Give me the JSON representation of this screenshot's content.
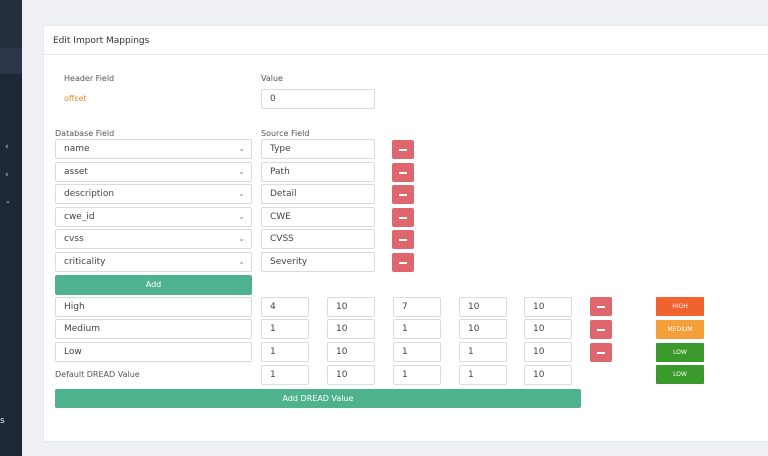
{
  "colors": {
    "sidebar": "#1e2736",
    "accent_green": "#4fb28f",
    "remove_red": "#e0666e",
    "badge_high": "#f0622e",
    "badge_medium": "#f59f3b",
    "badge_low": "#3a9a2c",
    "field_orange": "#e08a2b"
  },
  "sidebar": {
    "letter": "s"
  },
  "card": {
    "title": "Edit Import Mappings"
  },
  "header_section": {
    "header_field_label": "Header Field",
    "value_label": "Value",
    "field_name": "offset",
    "value": "0"
  },
  "mapping_section": {
    "database_field_label": "Database Field",
    "source_field_label": "Source Field",
    "rows": [
      {
        "db": "name",
        "src": "Type"
      },
      {
        "db": "asset",
        "src": "Path"
      },
      {
        "db": "description",
        "src": "Detail"
      },
      {
        "db": "cwe_id",
        "src": "CWE"
      },
      {
        "db": "cvss",
        "src": "CVSS"
      },
      {
        "db": "criticality",
        "src": "Severity"
      }
    ],
    "add_label": "Add"
  },
  "dread": {
    "rows": [
      {
        "name": "High",
        "v": [
          "4",
          "10",
          "7",
          "10",
          "10"
        ],
        "badge": "HIGH"
      },
      {
        "name": "Medium",
        "v": [
          "1",
          "10",
          "1",
          "10",
          "10"
        ],
        "badge": "MEDIUM"
      },
      {
        "name": "Low",
        "v": [
          "1",
          "10",
          "1",
          "1",
          "10"
        ],
        "badge": "LOW"
      }
    ],
    "default_label": "Default DREAD Value",
    "default_values": [
      "1",
      "10",
      "1",
      "1",
      "10"
    ],
    "default_badge": "LOW",
    "add_label": "Add DREAD Value"
  }
}
